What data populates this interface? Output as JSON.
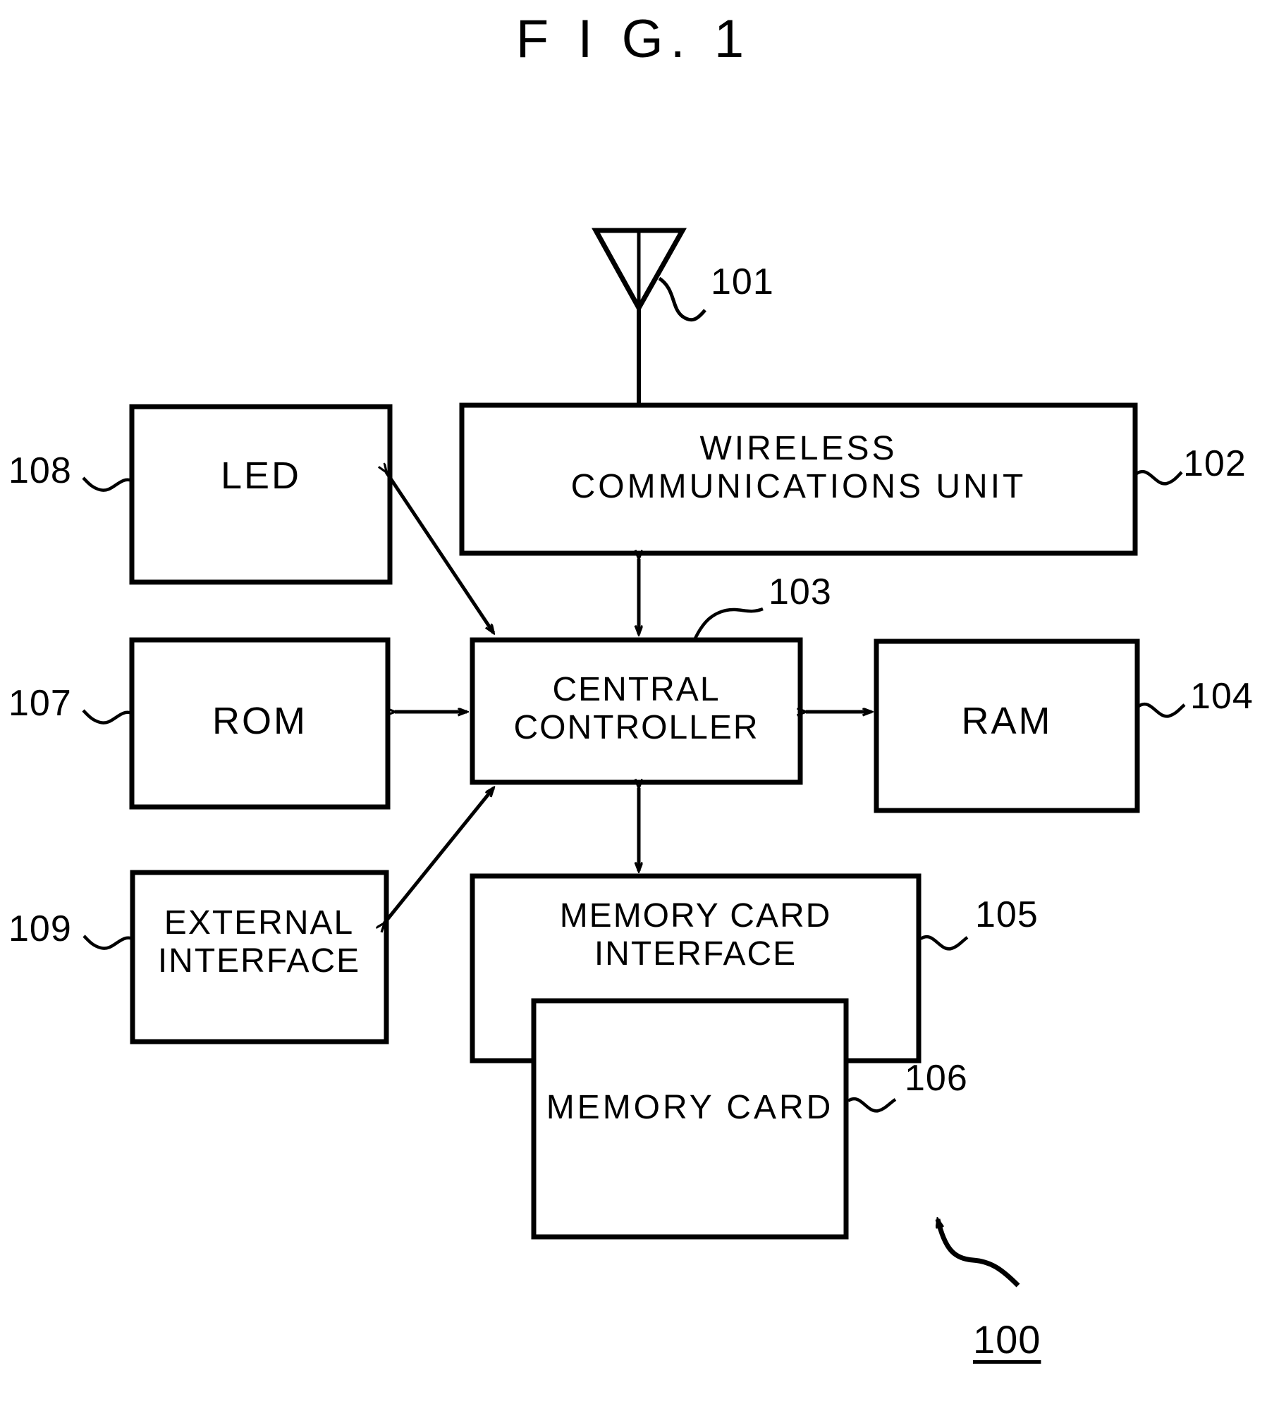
{
  "figure": {
    "title": "F I G. 1",
    "assembly_ref": "100"
  },
  "blocks": [
    {
      "id": "led",
      "label": "LED",
      "ref": "108",
      "ref_side": "left"
    },
    {
      "id": "wireless-communications-unit",
      "label": "WIRELESS\nCOMMUNICATIONS UNIT",
      "ref": "102",
      "ref_side": "right"
    },
    {
      "id": "central-controller",
      "label": "CENTRAL\nCONTROLLER",
      "ref": "103",
      "ref_side": "top-right"
    },
    {
      "id": "rom",
      "label": "ROM",
      "ref": "107",
      "ref_side": "left"
    },
    {
      "id": "ram",
      "label": "RAM",
      "ref": "104",
      "ref_side": "right"
    },
    {
      "id": "external-interface",
      "label": "EXTERNAL\nINTERFACE",
      "ref": "109",
      "ref_side": "left"
    },
    {
      "id": "memory-card-interface",
      "label": "MEMORY CARD\nINTERFACE",
      "ref": "105",
      "ref_side": "right"
    },
    {
      "id": "memory-card",
      "label": "MEMORY CARD",
      "ref": "106",
      "ref_side": "right"
    }
  ],
  "antenna": {
    "ref": "101",
    "icon": "antenna-triangle-icon"
  },
  "connections": [
    {
      "from": "antenna",
      "to": "wireless-communications-unit",
      "style": "plain"
    },
    {
      "from": "wireless-communications-unit",
      "to": "central-controller",
      "style": "double-arrow"
    },
    {
      "from": "rom",
      "to": "central-controller",
      "style": "double-arrow"
    },
    {
      "from": "central-controller",
      "to": "ram",
      "style": "double-arrow"
    },
    {
      "from": "central-controller",
      "to": "memory-card-interface",
      "style": "double-arrow"
    },
    {
      "from": "central-controller",
      "to": "led",
      "style": "double-arrow-diagonal"
    },
    {
      "from": "central-controller",
      "to": "external-interface",
      "style": "double-arrow-diagonal"
    }
  ],
  "refs": {
    "r100": "100",
    "r101": "101",
    "r102": "102",
    "r103": "103",
    "r104": "104",
    "r105": "105",
    "r106": "106",
    "r107": "107",
    "r108": "108",
    "r109": "109"
  },
  "labels": {
    "led": "LED",
    "wireless_line1": "WIRELESS",
    "wireless_line2": "COMMUNICATIONS UNIT",
    "wireless": "WIRELESS\nCOMMUNICATIONS UNIT",
    "central": "CENTRAL\nCONTROLLER",
    "rom": "ROM",
    "ram": "RAM",
    "external_interface": "EXTERNAL\nINTERFACE",
    "memory_card_interface": "MEMORY CARD\nINTERFACE",
    "memory_card": "MEMORY CARD"
  },
  "colors": {
    "stroke": "#000000",
    "background": "#ffffff"
  }
}
